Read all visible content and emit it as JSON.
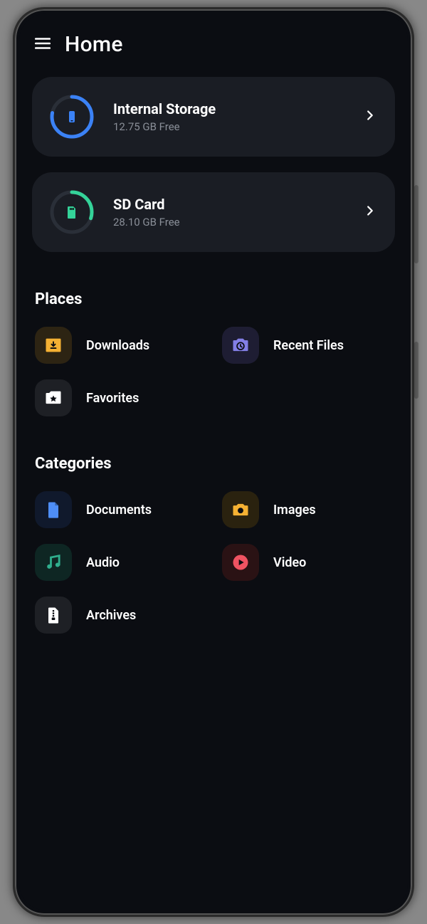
{
  "appbar": {
    "title": "Home"
  },
  "storage": [
    {
      "title": "Internal Storage",
      "subtitle": "12.75 GB Free",
      "color": "#3b82f6",
      "icon": "phone",
      "progress": 0.78
    },
    {
      "title": "SD Card",
      "subtitle": "28.10 GB Free",
      "color": "#34d399",
      "icon": "sdcard",
      "progress": 0.3
    }
  ],
  "sections": {
    "places_title": "Places",
    "categories_title": "Categories"
  },
  "places": [
    {
      "label": "Downloads",
      "icon": "download",
      "tint": "bg-amber",
      "fg": "#f5b133"
    },
    {
      "label": "Recent Files",
      "icon": "clock",
      "tint": "bg-indigo",
      "fg": "#837fe6"
    },
    {
      "label": "Favorites",
      "icon": "star",
      "tint": "bg-neutral",
      "fg": "#ffffff"
    }
  ],
  "categories": [
    {
      "label": "Documents",
      "icon": "file",
      "tint": "bg-blue",
      "fg": "#4e8ef7"
    },
    {
      "label": "Images",
      "icon": "camera",
      "tint": "bg-amber2",
      "fg": "#f5b133"
    },
    {
      "label": "Audio",
      "icon": "music",
      "tint": "bg-teal",
      "fg": "#2fae8d"
    },
    {
      "label": "Video",
      "icon": "play",
      "tint": "bg-red",
      "fg": "#ef5362"
    },
    {
      "label": "Archives",
      "icon": "archive",
      "tint": "bg-neutral",
      "fg": "#ffffff"
    }
  ]
}
